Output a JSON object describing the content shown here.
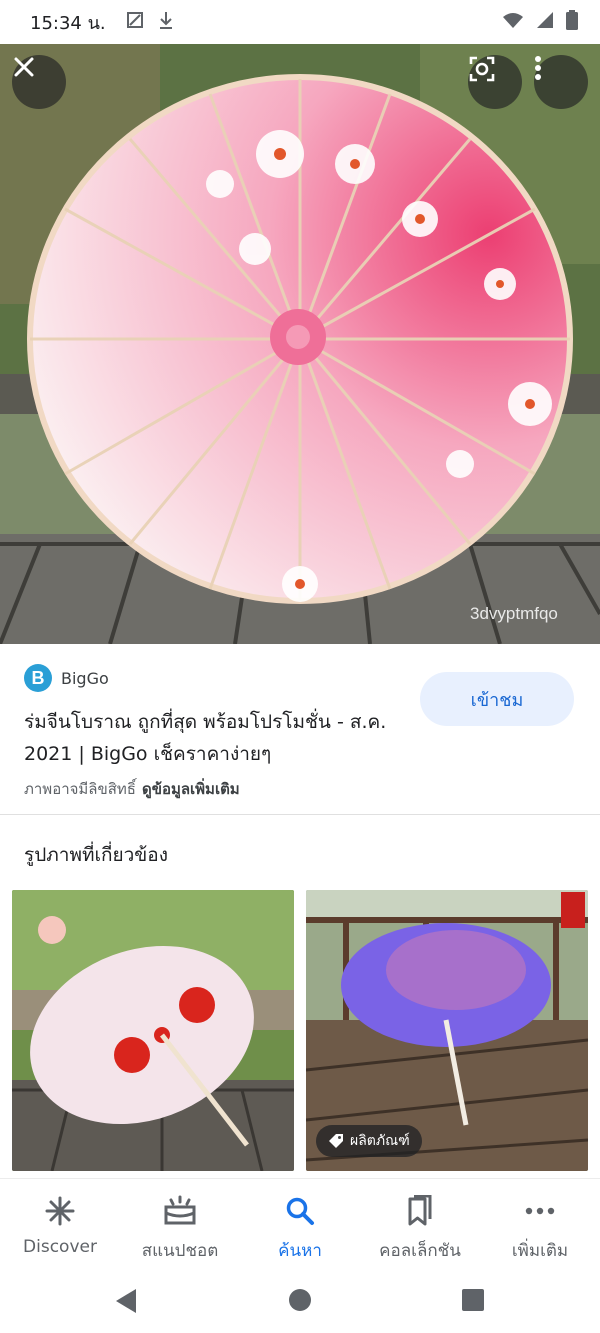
{
  "status_bar": {
    "time": "15:34 น.",
    "icons": [
      "screenshot-icon",
      "download-icon",
      "wifi-icon",
      "signal-icon",
      "battery-icon"
    ]
  },
  "hero": {
    "watermark": "3dvyptmfqo",
    "buttons": [
      "close-icon",
      "lens-icon",
      "more-vert-icon"
    ]
  },
  "source": {
    "logo_letter": "B",
    "name": "BigGo",
    "logo_color": "#2a9fd6"
  },
  "title": "ร่มจีนโบราณ ถูกที่สุด พร้อมโปรโมชั่น - ส.ค. 2021 | BigGo เช็คราคาง่ายๆ",
  "visit_button": "เข้าชม",
  "copyright": {
    "text": "ภาพอาจมีลิขสิทธิ์",
    "more_link": "ดูข้อมูลเพิ่มเติม"
  },
  "related": {
    "heading": "รูปภาพที่เกี่ยวข้อง",
    "product_badge": "ผลิตภัณฑ์"
  },
  "bottom_nav": {
    "items": [
      {
        "label": "Discover",
        "icon": "asterisk-icon"
      },
      {
        "label": "สแนปชอต",
        "icon": "snapshot-icon"
      },
      {
        "label": "ค้นหา",
        "icon": "search-icon",
        "active": true
      },
      {
        "label": "คอลเล็กชัน",
        "icon": "collections-icon"
      },
      {
        "label": "เพิ่มเติม",
        "icon": "more-horiz-icon"
      }
    ]
  },
  "colors": {
    "accent": "#1a73e8",
    "visit_bg": "#e8f0fe",
    "visit_text": "#1967d2"
  }
}
